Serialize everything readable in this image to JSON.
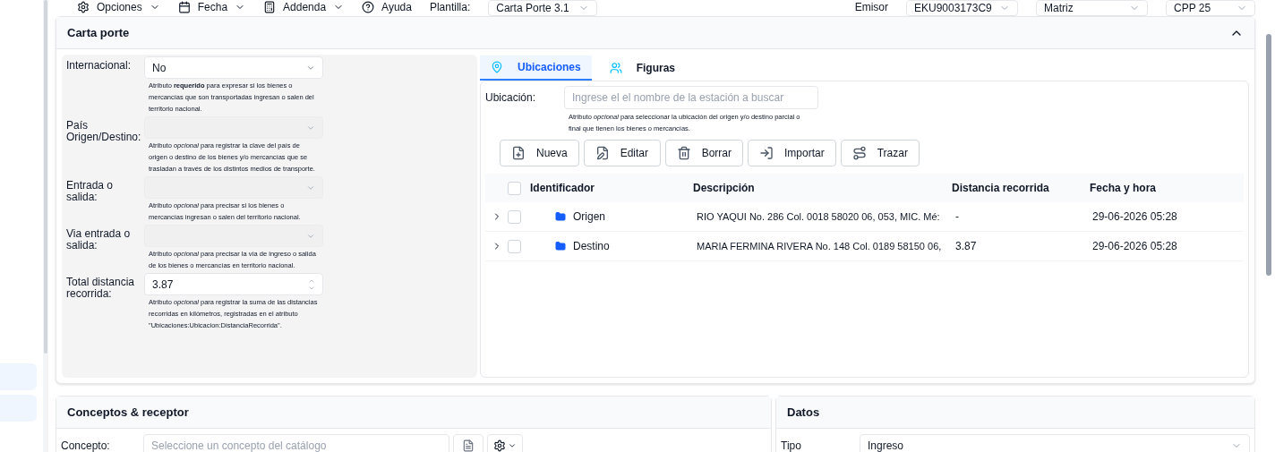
{
  "toolbar": {
    "menus": [
      {
        "label": "Opciones",
        "kind": "gear"
      },
      {
        "label": "Fecha",
        "kind": "calendar"
      },
      {
        "label": "Addenda",
        "kind": "calc"
      },
      {
        "label": "Ayuda",
        "kind": "help"
      }
    ],
    "plantilla": {
      "label": "Plantilla:",
      "value": "Carta Porte 3.1"
    },
    "emisor": {
      "label": "Emisor",
      "value": "EKU9003173C9"
    },
    "sucursal": {
      "value": "Matriz"
    },
    "serie": {
      "value": "CPP 25"
    }
  },
  "carta_porte": {
    "title": "Carta porte",
    "expanded": true,
    "fields": [
      {
        "label": "Internacional:",
        "value": "No",
        "kind": "select",
        "disabled": false,
        "help": "Atributo **requerido** para expresar si los bienes o mercancías que son transportadas ingresan o salen del territorio nacional."
      },
      {
        "label": "País Origen/Destino:",
        "kind": "select",
        "disabled": true,
        "help": "Atributo *opcional* para registrar la clave del país de origen o destino de los bienes y/o mercancías que se trasladan a través de los distintos medios de transporte."
      },
      {
        "label": "Entrada o salida:",
        "kind": "select",
        "disabled": true,
        "help": "Atributo *opcional* para precisar si los bienes o mercancías ingresan o salen del territorio nacional."
      },
      {
        "label": "Via entrada o salida:",
        "kind": "select",
        "disabled": true,
        "help": "Atributo *opcional* para precisar la vía de ingreso o salida de los bienes o mercancías en territorio nacional."
      },
      {
        "label": "Total distancia recorrida:",
        "value": "3.87",
        "kind": "number",
        "disabled": false,
        "help": "Atributo *opcional* para registrar la suma de las distancias recorridas en kilómetros, registradas en el atributo \"Ubicaciones:Ubicacion:DistanciaRecorrida\"."
      }
    ],
    "tabs": [
      {
        "label": "Ubicaciones",
        "kind": "pin",
        "selected": true
      },
      {
        "label": "Figuras",
        "kind": "people",
        "selected": false
      }
    ],
    "ubicacion": {
      "label": "Ubicación:",
      "placeholder": "Ingrese el el nombre de la estación a buscar",
      "help": "Atributo *opcional* para seleccionar la ubicación del origen y/o destino parcial o final que tienen los bienes o mercancías."
    },
    "actions": [
      {
        "label": "Nueva",
        "kind": "new"
      },
      {
        "label": "Editar",
        "kind": "edit"
      },
      {
        "label": "Borrar",
        "kind": "delete"
      },
      {
        "label": "Importar",
        "kind": "import"
      },
      {
        "label": "Trazar",
        "kind": "route"
      }
    ],
    "table": {
      "columns": [
        "Identificador",
        "Descripción",
        "Distancia recorrida",
        "Fecha y hora"
      ],
      "all_checked": false,
      "rows": [
        {
          "id": "Origen",
          "descripcion": "RIO YAQUI No. 286 Col. 0018 58020 06, 053, MIC. Mé:",
          "distancia": "-",
          "fecha": "29-06-2026 05:28",
          "checked": false,
          "expanded": false
        },
        {
          "id": "Destino",
          "descripcion": "MARIA FERMINA RIVERA No. 148 Col. 0189 58150 06,",
          "distancia": "3.87",
          "fecha": "29-06-2026 05:28",
          "checked": false,
          "expanded": false
        }
      ]
    }
  },
  "conceptos": {
    "title": "Conceptos & receptor",
    "concepto": {
      "label": "Concepto:",
      "placeholder": "Seleccione un concepto del catálogo"
    }
  },
  "datos": {
    "title": "Datos",
    "tipo": {
      "label": "Tipo",
      "value": "Ingreso"
    }
  }
}
